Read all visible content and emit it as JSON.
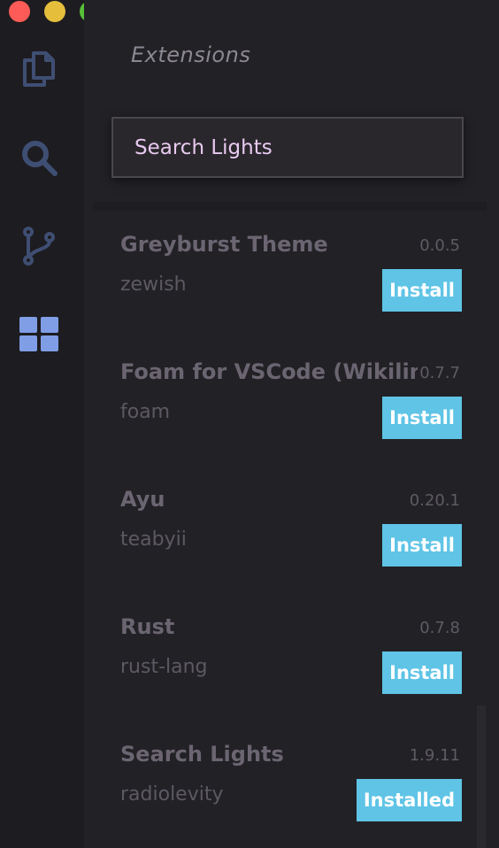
{
  "window": {
    "controls": [
      "close",
      "minimize",
      "maximize"
    ],
    "colors": {
      "close": "#fc5b57",
      "minimize": "#e5bf3c",
      "maximize": "#57c038"
    }
  },
  "activity_bar": {
    "items": [
      {
        "icon": "files-icon",
        "active": false
      },
      {
        "icon": "search-icon",
        "active": false
      },
      {
        "icon": "source-control-icon",
        "active": false
      },
      {
        "icon": "extensions-icon",
        "active": true
      }
    ],
    "colors": {
      "inactive": "#3f4e73",
      "active": "#7f9ee6"
    }
  },
  "sidebar": {
    "title": "Extensions",
    "search": {
      "value": "Search Lights",
      "placeholder": ""
    }
  },
  "extensions": [
    {
      "name": "Greyburst Theme",
      "version": "0.0.5",
      "author": "zewish",
      "action": "Install"
    },
    {
      "name": "Foam for VSCode (Wikilinks)",
      "version": "0.7.7",
      "author": "foam",
      "action": "Install"
    },
    {
      "name": "Ayu",
      "version": "0.20.1",
      "author": "teabyii",
      "action": "Install"
    },
    {
      "name": "Rust",
      "version": "0.7.8",
      "author": "rust-lang",
      "action": "Install"
    },
    {
      "name": "Search Lights",
      "version": "1.9.11",
      "author": "radiolevity",
      "action": "Installed"
    }
  ],
  "accent_color": "#5fc4e6"
}
